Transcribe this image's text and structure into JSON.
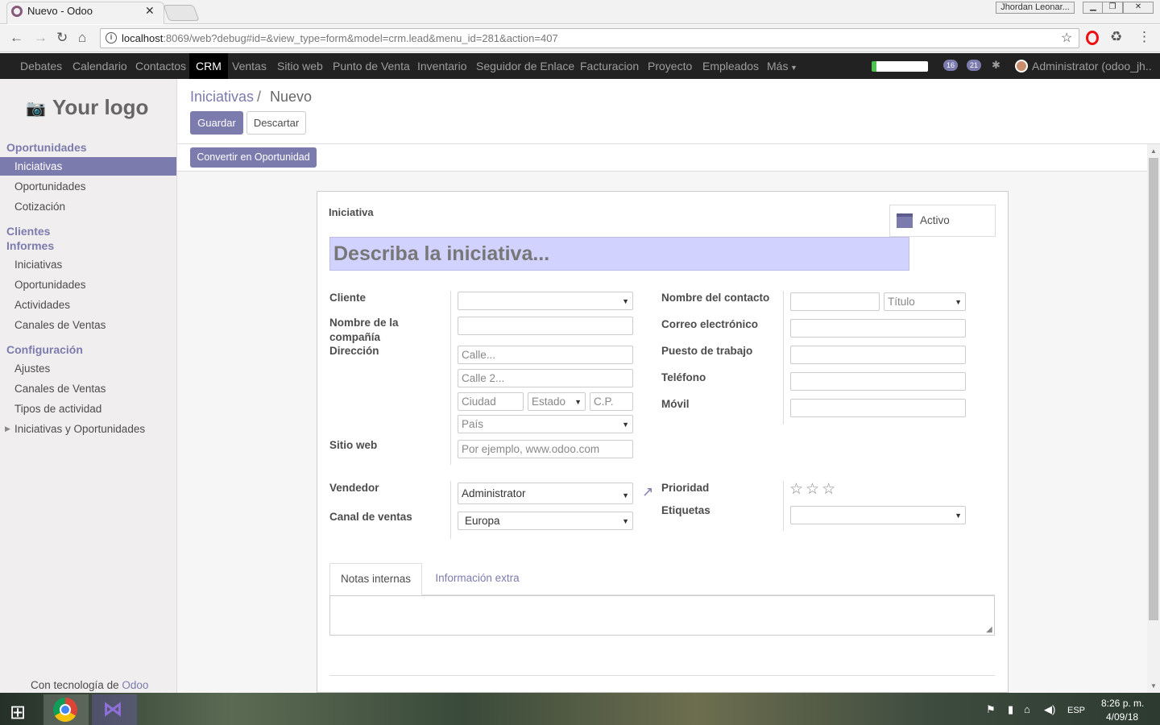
{
  "browser": {
    "tab_title": "Nuevo - Odoo",
    "profile_name": "Jhordan Leonar...",
    "url_host": "localhost",
    "url_rest": ":8069/web?debug#id=&view_type=form&model=crm.lead&menu_id=281&action=407"
  },
  "topnav": {
    "items": [
      "Debates",
      "Calendario",
      "Contactos",
      "CRM",
      "Ventas",
      "Sitio web",
      "Punto de Venta",
      "Inventario",
      "Seguidor de Enlace",
      "Facturacion",
      "Proyecto",
      "Empleados",
      "Más"
    ],
    "badge_messages": "16",
    "badge_activities": "21",
    "user": "Administrator (odoo_jh..."
  },
  "sidebar": {
    "logo": "Your logo",
    "sections": [
      {
        "title": "Oportunidades",
        "items": [
          "Iniciativas",
          "Oportunidades",
          "Cotización"
        ]
      },
      {
        "title": "Clientes"
      },
      {
        "title": "Informes",
        "items": [
          "Iniciativas",
          "Oportunidades",
          "Actividades",
          "Canales de Ventas"
        ]
      },
      {
        "title": "Configuración",
        "items": [
          "Ajustes",
          "Canales de Ventas",
          "Tipos de actividad",
          "Iniciativas y Oportunidades"
        ]
      }
    ],
    "powered_prefix": "Con tecnología de",
    "powered_brand": "Odoo"
  },
  "control": {
    "breadcrumb_parent": "Iniciativas",
    "breadcrumb_sep": "/",
    "breadcrumb_current": "Nuevo",
    "save": "Guardar",
    "discard": "Descartar",
    "convert": "Convertir en Oportunidad"
  },
  "form": {
    "heading": "Iniciativa",
    "active_label": "Activo",
    "name_placeholder": "Describa la iniciativa...",
    "labels": {
      "cliente": "Cliente",
      "compania": "Nombre de la compañía",
      "direccion": "Dirección",
      "sitio_web": "Sitio web",
      "contacto": "Nombre del contacto",
      "correo": "Correo electrónico",
      "puesto": "Puesto de trabajo",
      "telefono": "Teléfono",
      "movil": "Móvil",
      "vendedor": "Vendedor",
      "canal": "Canal de ventas",
      "prioridad": "Prioridad",
      "etiquetas": "Etiquetas"
    },
    "placeholders": {
      "calle": "Calle...",
      "calle2": "Calle 2...",
      "ciudad": "Ciudad",
      "estado": "Estado",
      "cp": "C.P.",
      "pais": "País",
      "web": "Por ejemplo, www.odoo.com",
      "titulo": "Título"
    },
    "values": {
      "vendedor": "Administrator",
      "canal": "Europa"
    },
    "priority_stars": "☆☆☆",
    "tabs": [
      "Notas internas",
      "Información extra"
    ]
  },
  "taskbar": {
    "lang": "ESP",
    "time": "8:26 p. m.",
    "date": "4/09/18"
  }
}
